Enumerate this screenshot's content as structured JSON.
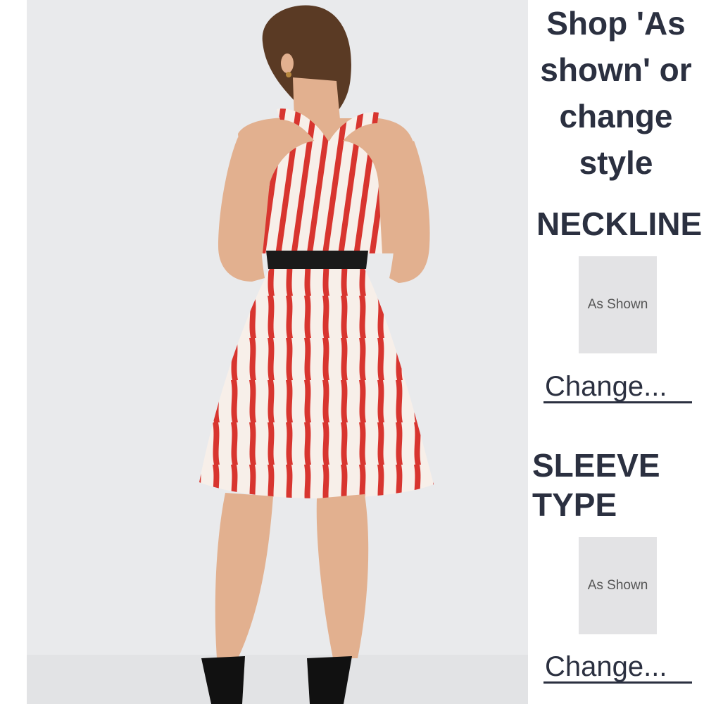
{
  "product": {
    "image_alt": "Back view of model wearing red and white striped halter dress with black waist belt"
  },
  "panel": {
    "heading_lines": [
      "Shop 'As",
      "shown' or",
      "change",
      "style"
    ]
  },
  "options": {
    "neckline": {
      "title": "NECKLINE",
      "swatch_label": "As Shown",
      "change_label": "Change..."
    },
    "sleeve": {
      "title_lines": [
        "SLEEVE",
        "TYPE"
      ],
      "swatch_label": "As Shown",
      "change_label": "Change..."
    }
  },
  "colors": {
    "stripe_red": "#d8352f",
    "stripe_white": "#f7efe9",
    "belt": "#1a1a1a",
    "skin": "#e2b08f",
    "hair": "#5a3a24",
    "photo_bg": "#e9eaec",
    "text": "#2b3040"
  }
}
